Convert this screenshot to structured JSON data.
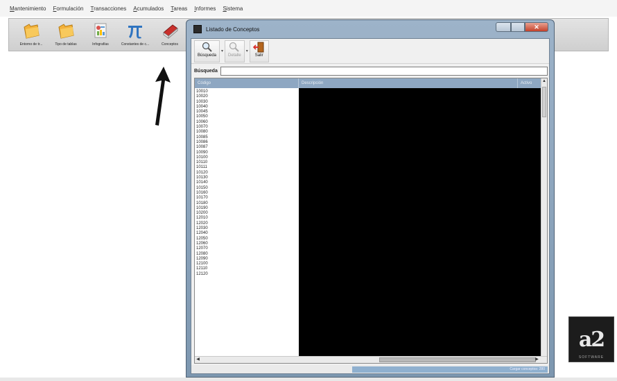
{
  "menubar": {
    "items": [
      {
        "underline": "M",
        "rest": "antenimiento"
      },
      {
        "underline": "F",
        "rest": "ormulación"
      },
      {
        "underline": "T",
        "rest": "ransacciones"
      },
      {
        "underline": "A",
        "rest": "cumulados"
      },
      {
        "underline": "T",
        "rest": "areas"
      },
      {
        "underline": "I",
        "rest": "nformes"
      },
      {
        "underline": "S",
        "rest": "istema"
      }
    ]
  },
  "toolbar": {
    "buttons": [
      {
        "label": "Entorno de tr..."
      },
      {
        "label": "Tipo de tablas"
      },
      {
        "label": "Infografías"
      },
      {
        "label": "Constantes de c..."
      },
      {
        "label": "Conceptos"
      }
    ]
  },
  "dialog": {
    "title": "Listado de Conceptos",
    "close_glyph": "✕",
    "toolbar": {
      "search_label": "Búsqueda",
      "detail_label": "Detalle",
      "exit_label": "Salir",
      "dropdown_glyph": "▾"
    },
    "search": {
      "label": "Búsqueda",
      "value": ""
    },
    "grid": {
      "columns": [
        "Código",
        "Descripción",
        "Activo"
      ],
      "codes": [
        "10010",
        "10020",
        "10030",
        "10040",
        "10045",
        "10050",
        "10060",
        "10070",
        "10080",
        "10085",
        "10086",
        "10087",
        "10090",
        "10100",
        "10110",
        "10111",
        "10120",
        "10130",
        "10140",
        "10150",
        "10160",
        "10170",
        "10180",
        "10190",
        "10200",
        "12010",
        "12020",
        "12030",
        "12040",
        "12050",
        "12060",
        "12070",
        "12080",
        "12090",
        "12100",
        "12110",
        "12120"
      ]
    },
    "status": {
      "right_text": "Cargar conceptos: 280"
    }
  },
  "logo": {
    "text": "a2",
    "subtext": "SOFTWARE"
  },
  "colors": {
    "window_frame": "#8ea7c2",
    "grid_header": "#8ea7c2",
    "redacted_area": "#000000",
    "close_button": "#c4412a"
  },
  "icons": [
    "folder-icon",
    "folder-icon",
    "infographic-icon",
    "pi-icon",
    "book-icon",
    "magnifier-icon",
    "magnifier-disabled-icon",
    "exit-door-icon",
    "up-arrow-annotation"
  ]
}
